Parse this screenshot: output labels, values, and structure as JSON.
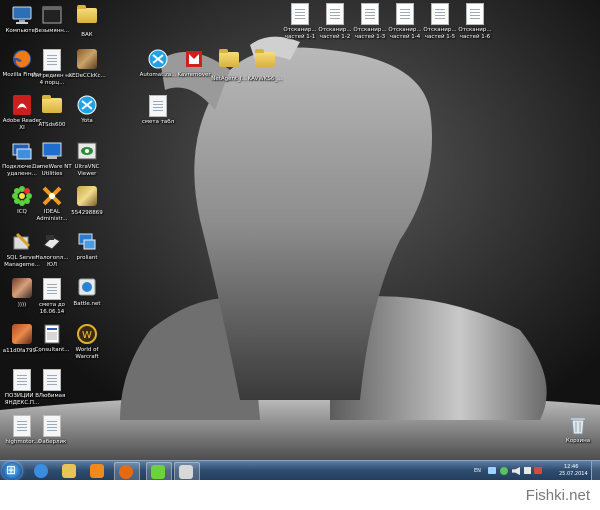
{
  "desktop": {
    "left_icons": [
      {
        "label": "Компьютер",
        "kind": "computer"
      },
      {
        "label": "Безымянн...",
        "kind": "dark-window"
      },
      {
        "label": "ВАК",
        "kind": "folder"
      },
      {
        "label": "Mozilla Firefox",
        "kind": "firefox"
      },
      {
        "label": "Ингредиен на 4 порц...",
        "kind": "doc"
      },
      {
        "label": "XEDeCCkKc...",
        "kind": "photo"
      },
      {
        "label": "Adobe Reader XI",
        "kind": "pdf"
      },
      {
        "label": "ATSds600",
        "kind": "folder"
      },
      {
        "label": "Yota",
        "kind": "yota"
      },
      {
        "label": "Подключе... к удаленн...",
        "kind": "rdp"
      },
      {
        "label": "DameWare NT Utilities",
        "kind": "dameware"
      },
      {
        "label": "UltraVNC Viewer",
        "kind": "vnc"
      },
      {
        "label": "ICQ",
        "kind": "icq"
      },
      {
        "label": "IDEAL Administr...",
        "kind": "ideal"
      },
      {
        "label": "554298869",
        "kind": "photo2"
      },
      {
        "label": "SQL Server Manageme...",
        "kind": "sql"
      },
      {
        "label": "Налогопл... ЮЛ",
        "kind": "nalog"
      },
      {
        "label": "proliant",
        "kind": "proliant"
      },
      {
        "label": "))))",
        "kind": "photo3"
      },
      {
        "label": "смета до 16.06.14",
        "kind": "doc"
      },
      {
        "label": "Battle.net",
        "kind": "battle"
      },
      {
        "label": "a11d0fa799...",
        "kind": "photo4"
      },
      {
        "label": "Consultant...",
        "kind": "consult"
      },
      {
        "label": "World of Warcraft",
        "kind": "wow"
      },
      {
        "label": "ПОЗИЦИИ В ЯНДЕКС.П...",
        "kind": "doc"
      },
      {
        "label": "Любимая",
        "kind": "doc"
      },
      {
        "label": "highmotor...",
        "kind": "doc"
      },
      {
        "label": "Фаберлик",
        "kind": "doc"
      }
    ],
    "mid_icons": [
      {
        "label": "Automatiza...",
        "kind": "yota"
      },
      {
        "label": "Kavremover",
        "kind": "kav"
      },
      {
        "label": "NetAgent_l...",
        "kind": "folder"
      },
      {
        "label": "KAVWKS6_...",
        "kind": "folder"
      },
      {
        "label": "смета табл",
        "kind": "doc"
      }
    ],
    "top_icons": [
      {
        "label": "Отсканир... частей 1-1",
        "kind": "scan"
      },
      {
        "label": "Отсканир... частей 1-2",
        "kind": "scan"
      },
      {
        "label": "Отсканир... частей 1-3",
        "kind": "scan"
      },
      {
        "label": "Отсканир... частей 1-4",
        "kind": "scan"
      },
      {
        "label": "Отсканир... частей 1-5",
        "kind": "scan"
      },
      {
        "label": "Отсканир... частей 1-6",
        "kind": "scan"
      }
    ],
    "recycle_bin": {
      "label": "Корзина"
    }
  },
  "taskbar": {
    "pinned": [
      {
        "name": "ie",
        "color": "#3b8de0"
      },
      {
        "name": "explorer",
        "color": "#e8c35a"
      },
      {
        "name": "media-player",
        "color": "#f08a1c"
      },
      {
        "name": "firefox",
        "color": "#e66a14",
        "active": true
      },
      {
        "name": "icq",
        "color": "#6bd33a",
        "active": true
      },
      {
        "name": "document",
        "color": "#d8d8d8",
        "active": true
      }
    ],
    "tray": {
      "language": "EN",
      "time": "12:46",
      "date": "25.07.2014"
    }
  },
  "footer": {
    "brand": "Fishki.net"
  },
  "colors": {
    "taskbar": "#2f4d70",
    "wallpaper_bg": "#1e1e1e"
  }
}
